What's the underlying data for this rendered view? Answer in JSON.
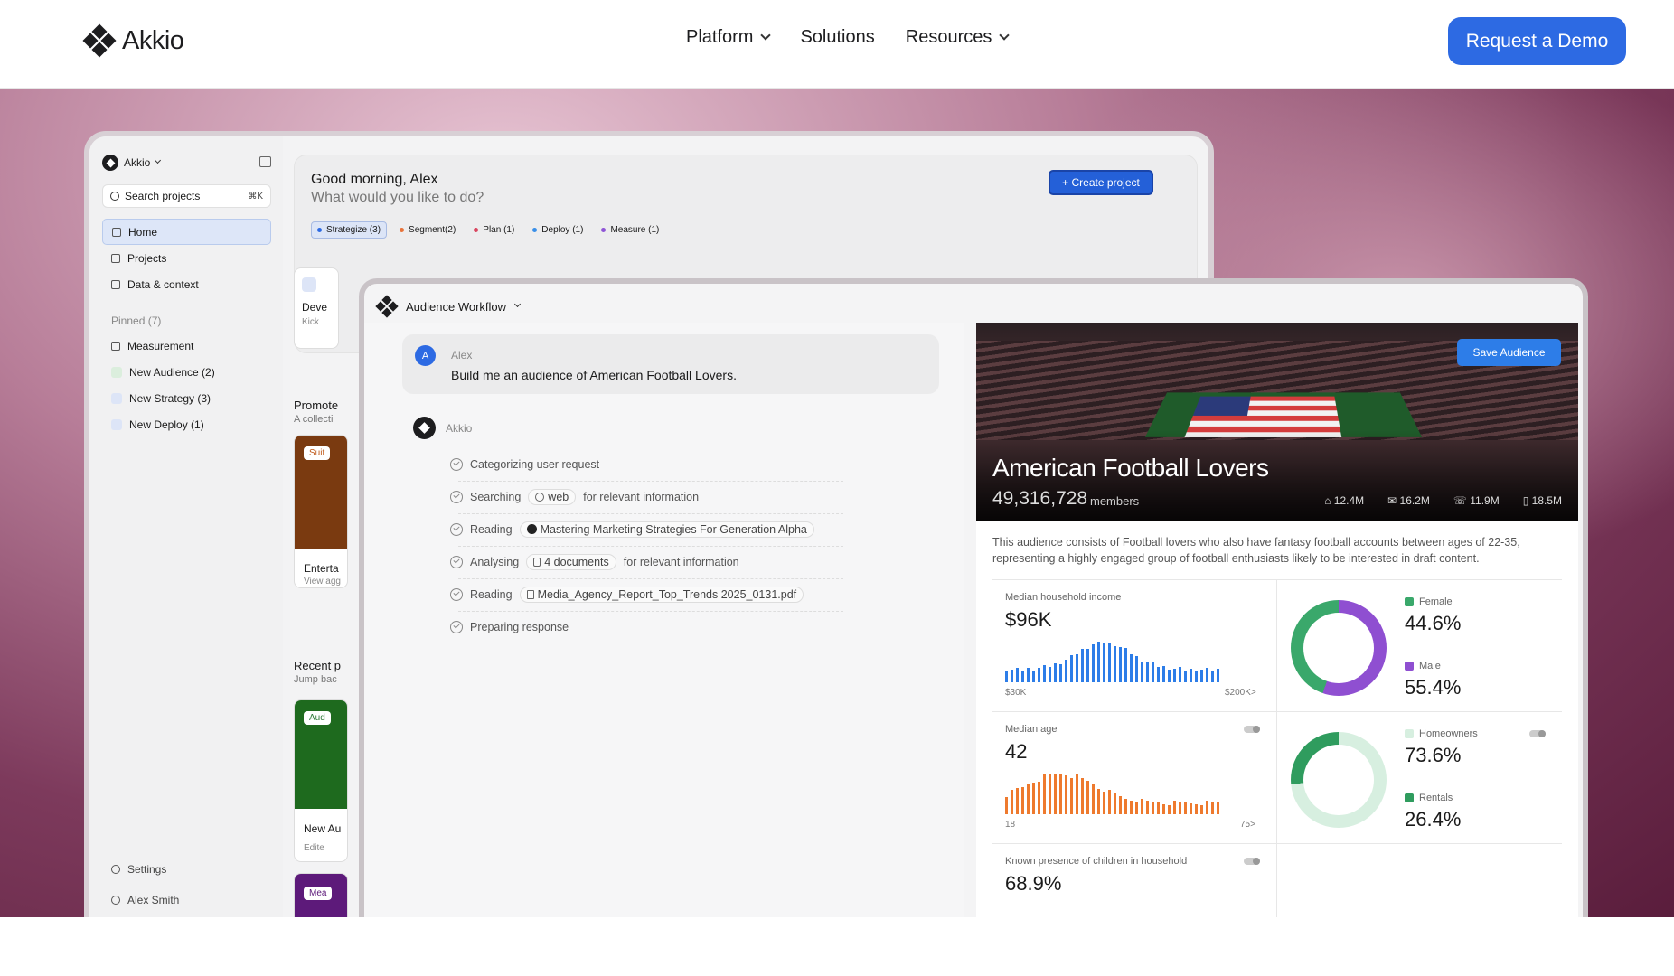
{
  "nav": {
    "brand": "Akkio",
    "menu": [
      "Platform",
      "Solutions",
      "Resources"
    ],
    "cta": "Request a Demo"
  },
  "app": {
    "brand": "Akkio",
    "search_placeholder": "Search projects",
    "search_kbd": "⌘K",
    "sidebar": [
      {
        "label": "Home",
        "active": true
      },
      {
        "label": "Projects"
      },
      {
        "label": "Data & context"
      }
    ],
    "pinned_label": "Pinned (7)",
    "pinned": [
      "Measurement",
      "New Audience (2)",
      "New Strategy (3)",
      "New Deploy (1)"
    ],
    "footer": [
      "Settings",
      "Alex Smith"
    ],
    "greeting": "Good morning, Alex",
    "greeting_sub": "What would you like to do?",
    "create_button": "+ Create project",
    "chips": [
      {
        "label": "Strategize (3)",
        "color": "#2d6ae3"
      },
      {
        "label": "Segment(2)",
        "color": "#e8733a"
      },
      {
        "label": "Plan (1)",
        "color": "#d9455f"
      },
      {
        "label": "Deploy (1)",
        "color": "#3a8fe8"
      },
      {
        "label": "Measure (1)",
        "color": "#8f55d6"
      }
    ],
    "card_title": "Deve",
    "card_sub": "Kick",
    "promoted_title": "Promote",
    "promoted_sub": "A collecti",
    "tile1_tag": "Suit",
    "tile1_title": "Enterta",
    "tile1_sub": "View agg",
    "recent_title": "Recent p",
    "recent_sub": "Jump bac",
    "tile2_tag": "Aud",
    "tile2_title": "New Au",
    "tile2_sub": "Edite",
    "tile3_tag": "Mea"
  },
  "workflow": {
    "title": "Audience Workflow",
    "user_initial": "A",
    "user_name": "Alex",
    "user_message": "Build me an audience of American Football Lovers.",
    "assistant_name": "Akkio",
    "steps": [
      {
        "verb": "Categorizing user request",
        "pill": "",
        "rest": ""
      },
      {
        "verb": "Searching",
        "pill": "web",
        "rest": "for relevant information"
      },
      {
        "verb": "Reading",
        "pill": "Mastering Marketing Strategies For Generation Alpha",
        "rest": ""
      },
      {
        "verb": "Analysing",
        "pill": "4 documents",
        "rest": "for relevant information"
      },
      {
        "verb": "Reading",
        "pill": "Media_Agency_Report_Top_Trends 2025_0131.pdf",
        "rest": ""
      },
      {
        "verb": "Preparing response",
        "pill": "",
        "rest": ""
      }
    ]
  },
  "audience": {
    "save": "Save Audience",
    "title": "American Football Lovers",
    "count": "49,316,728",
    "count_unit": "members",
    "stats": [
      "12.4M",
      "16.2M",
      "11.9M",
      "18.5M"
    ],
    "description": "This audience consists of Football lovers who also have fantasy football accounts between ages of 22-35, representing a highly engaged group of football enthusiasts likely to be interested in draft content.",
    "income_label": "Median household income",
    "income_value": "$96K",
    "income_axis": [
      "$30K",
      "$200K>"
    ],
    "age_label": "Median age",
    "age_value": "42",
    "age_axis": [
      "18",
      "75>"
    ],
    "children_label": "Known presence of children in household",
    "children_value": "68.9%",
    "gender": [
      {
        "label": "Female",
        "value": "44.6%",
        "color": "#3aa86b",
        "frac": 0.446
      },
      {
        "label": "Male",
        "value": "55.4%",
        "color": "#8f4fd1",
        "frac": 0.554
      }
    ],
    "home": [
      {
        "label": "Homeowners",
        "value": "73.6%",
        "color": "#d7efe0",
        "frac": 0.736
      },
      {
        "label": "Rentals",
        "value": "26.4%",
        "color": "#2f9c5e",
        "frac": 0.264
      }
    ]
  }
}
